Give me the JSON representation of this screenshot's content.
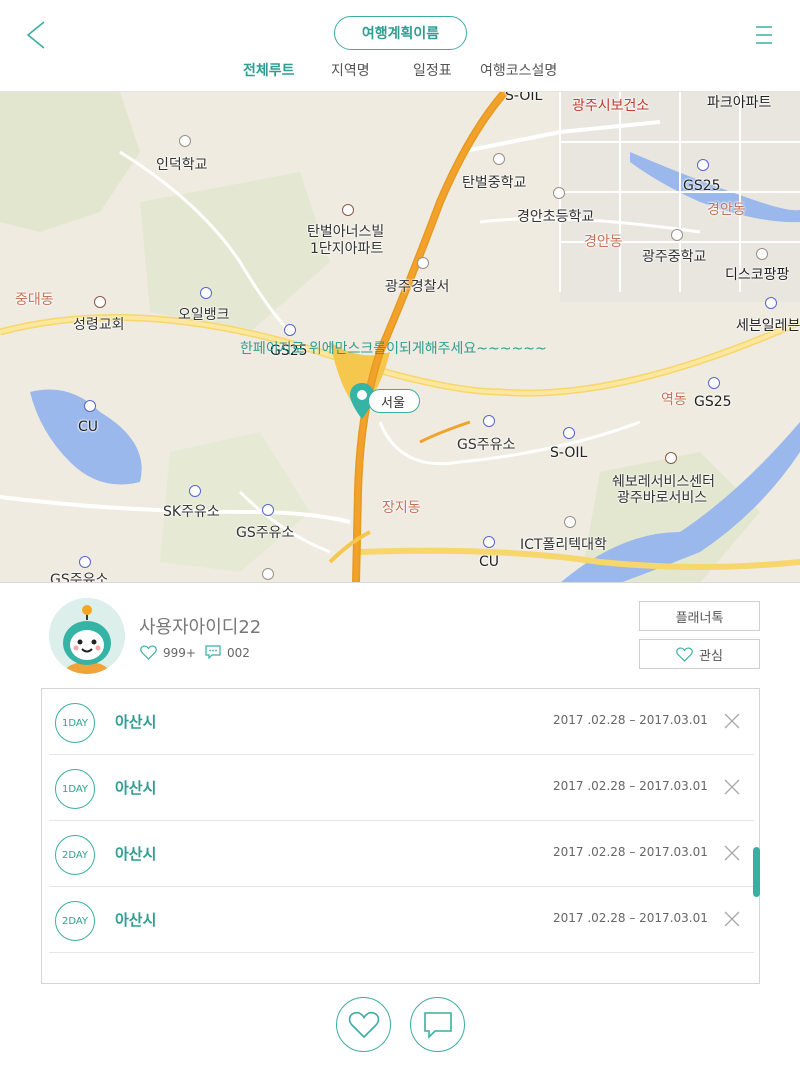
{
  "header": {
    "plan_name": "여행계획이름",
    "tabs": [
      {
        "label": "전체루트",
        "active": true
      },
      {
        "label": "지역명",
        "active": false
      },
      {
        "label": "일정표",
        "active": false
      },
      {
        "label": "여행코스설명",
        "active": false
      }
    ]
  },
  "map": {
    "scroll_hint": "한페이지로 위에만스크롤이되게해주세요~~~~~~",
    "marker_label": "서울",
    "labels": {
      "soil_top": "S-OIL",
      "health_center": "광주시보건소",
      "park_apt": "파크아파트",
      "indeok_school": "인덕학교",
      "tanbeol_middle": "탄벌중학교",
      "gs25_a": "GS25",
      "gyeongan_dong": "경안동",
      "gyeongan_elem": "경안초등학교",
      "tanbeol_apt_1": "탄벌아너스빌",
      "tanbeol_apt_2": "1단지아파트",
      "gyeongan_dong2": "경안동",
      "gwangju_middle": "광주중학교",
      "disco": "디스코팡팡",
      "police": "광주경찰서",
      "jungdae": "중대동",
      "seongryeong": "성령교회",
      "oil_bank": "오일뱅크",
      "seven_eleven": "세븐일레븐",
      "gs25_b": "GS25",
      "yeokdong": "역동",
      "gs25_c": "GS25",
      "cu_a": "CU",
      "gs_station_a": "GS주유소",
      "soil_b": "S-OIL",
      "service_1": "쉐보레서비스센터",
      "service_2": "광주바로서비스",
      "sk_station": "SK주유소",
      "jangji": "장지동",
      "gs_station_b": "GS주유소",
      "ict": "ICT폴리텍대학",
      "cu_b": "CU",
      "gs_station_c": "GS주유소"
    }
  },
  "profile": {
    "user_id": "사용자아이디22",
    "likes": "999+",
    "comments": "002",
    "planner_talk": "플래너톡",
    "interest": "관심"
  },
  "itinerary": [
    {
      "day": "1DAY",
      "city": "아산시",
      "dates": "2017 .02.28  –  2017.03.01"
    },
    {
      "day": "1DAY",
      "city": "아산시",
      "dates": "2017 .02.28  –  2017.03.01"
    },
    {
      "day": "2DAY",
      "city": "아산시",
      "dates": "2017 .02.28  –  2017.03.01"
    },
    {
      "day": "2DAY",
      "city": "아산시",
      "dates": "2017 .02.28  –  2017.03.01"
    }
  ],
  "colors": {
    "accent": "#3aaea2",
    "highway": "#f2a22b",
    "road": "#f7d66b",
    "water": "#9bb8ec"
  }
}
